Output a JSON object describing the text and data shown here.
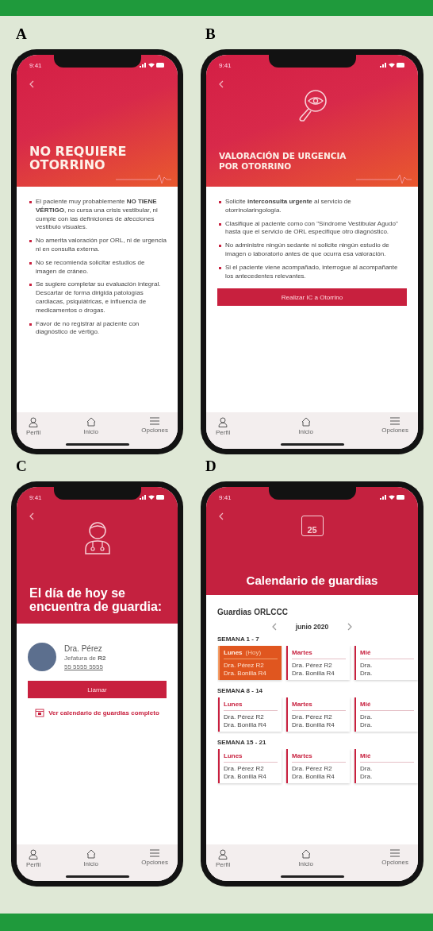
{
  "panels": [
    {
      "label": "A",
      "kind": "alert",
      "status_time": "9:41",
      "title": "NO REQUIERE OTORRINO",
      "bullets": [
        "El paciente muy probablemente **NO TIENE VÉRTIGO**, no cursa una crisis vestibular, ni cumple con las definiciones de afecciones vestibulo visuales.",
        "No amerita valoración por ORL, ni de urgencia ni en consulta externa.",
        "No se recomienda solicitar estudios de imagen de cráneo.",
        "Se sugiere completar su evaluación integral. Descartar de forma dirigida patologías cardiacas, psiquiátricas, e influencia de medicamentos o drogas.",
        "Favor de no registrar al paciente con diagnóstico de vértigo."
      ],
      "tabs": [
        "Perfil",
        "Inicio",
        "Opciones"
      ]
    },
    {
      "label": "B",
      "kind": "urgent",
      "status_time": "9:41",
      "title": "VALORACIÓN DE URGENCIA POR OTORRINO",
      "bullets": [
        "Solicite **interconsulta urgente** al servicio de otorrinolaringología.",
        "Clasifique al paciente como con \"Síndrome Vestibular Agudo\" hasta que el servicio de ORL especifique otro diagnóstico.",
        "No administre ningún sedante ni solicite ningún estudio de imagen o laboratorio antes de que ocurra esa valoración.",
        "Si el paciente viene acompañado, interrogue al acompañante los antecedentes relevantes."
      ],
      "button": "Realizar IC a Otorrino",
      "tabs": [
        "Perfil",
        "Inicio",
        "Opciones"
      ]
    },
    {
      "label": "C",
      "kind": "on_call",
      "status_time": "9:41",
      "title": "El día de hoy se encuentra de guardia:",
      "doctor": {
        "name": "Dra. Pérez",
        "role": "Jefatura de **R2**",
        "phone": "55 5555 5555"
      },
      "button": "Llamar",
      "link": "Ver calendario de guardias completo",
      "tabs": [
        "Perfil",
        "Inicio",
        "Opciones"
      ]
    },
    {
      "label": "D",
      "kind": "calendar",
      "status_time": "9:41",
      "icon_text": "25",
      "title": "Calendario de guardias",
      "section": "Guardias ORLCCC",
      "month": "junio 2020",
      "weeks": [
        {
          "label": "SEMANA 1 - 7",
          "days": [
            {
              "day": "Lunes",
              "tag": "(Hoy)",
              "selected": true,
              "doctors": [
                "Dra. Pérez R2",
                "Dra. Bonilla R4"
              ]
            },
            {
              "day": "Martes",
              "selected": false,
              "doctors": [
                "Dra. Pérez R2",
                "Dra. Bonilla R4"
              ]
            },
            {
              "day": "Mié",
              "selected": false,
              "doctors": [
                "Dra.",
                "Dra."
              ]
            }
          ]
        },
        {
          "label": "SEMANA 8 - 14",
          "days": [
            {
              "day": "Lunes",
              "selected": false,
              "doctors": [
                "Dra. Pérez R2",
                "Dra. Bonilla R4"
              ]
            },
            {
              "day": "Martes",
              "selected": false,
              "doctors": [
                "Dra. Pérez R2",
                "Dra. Bonilla R4"
              ]
            },
            {
              "day": "Mié",
              "selected": false,
              "doctors": [
                "Dra.",
                "Dra."
              ]
            }
          ]
        },
        {
          "label": "SEMANA 15 - 21",
          "days": [
            {
              "day": "Lunes",
              "selected": false,
              "doctors": [
                "Dra. Pérez R2",
                "Dra. Bonilla R4"
              ]
            },
            {
              "day": "Martes",
              "selected": false,
              "doctors": [
                "Dra. Pérez R2",
                "Dra. Bonilla R4"
              ]
            },
            {
              "day": "Mié",
              "selected": false,
              "doctors": [
                "Dra.",
                "Dra."
              ]
            }
          ]
        }
      ],
      "tabs": [
        "Perfil",
        "Inicio",
        "Opciones"
      ]
    }
  ]
}
